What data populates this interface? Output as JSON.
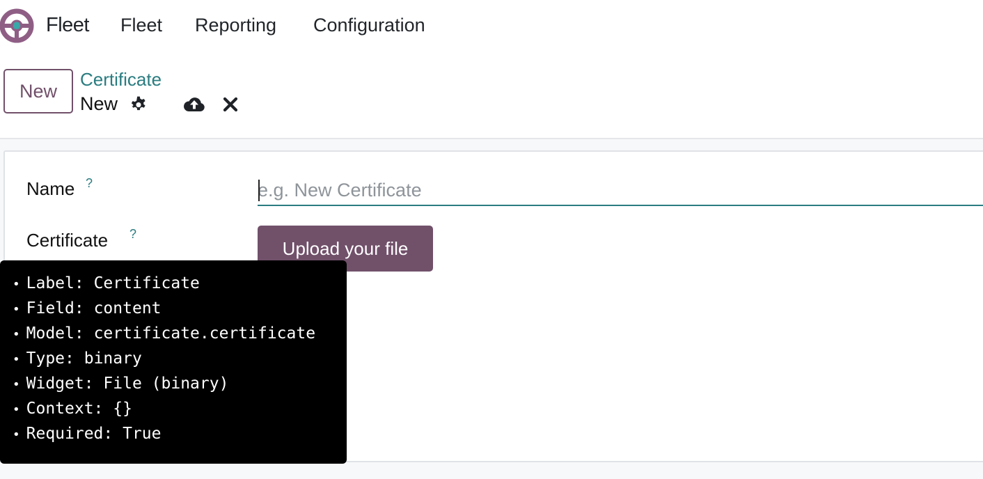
{
  "navbar": {
    "app_name": "Fleet",
    "menu": [
      "Fleet",
      "Reporting",
      "Configuration"
    ]
  },
  "control_panel": {
    "new_button": "New",
    "breadcrumb": "Certificate",
    "record_name": "New",
    "icons": [
      "gear-icon",
      "cloud-upload-icon",
      "close-icon"
    ]
  },
  "form": {
    "name_label": "Name",
    "name_help": "?",
    "name_placeholder": "e.g. New Certificate",
    "name_value": "",
    "certificate_label": "Certificate",
    "certificate_help": "?",
    "upload_button": "Upload your file"
  },
  "tooltip": {
    "items": [
      {
        "key": "Label:",
        "value": "Certificate"
      },
      {
        "key": "Field:",
        "value": "content"
      },
      {
        "key": "Model:",
        "value": "certificate.certificate"
      },
      {
        "key": "Type:",
        "value": "binary"
      },
      {
        "key": "Widget:",
        "value": "File (binary)"
      },
      {
        "key": "Context:",
        "value": "{}"
      },
      {
        "key": "Required:",
        "value": "True"
      }
    ]
  },
  "colors": {
    "brand": "#71506a",
    "accent": "#2a7c80",
    "tooltip_bg": "#000000"
  }
}
